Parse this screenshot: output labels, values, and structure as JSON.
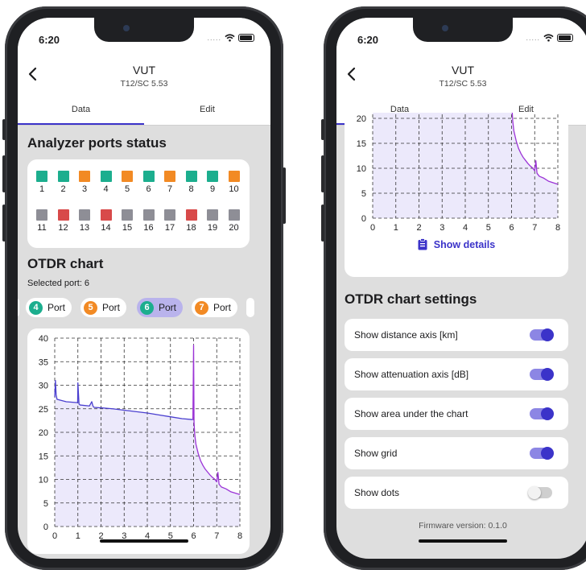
{
  "colors": {
    "accent": "#3b33c9",
    "port_ok": "#1cae8e",
    "port_warn": "#f28a24",
    "port_error": "#d84a4a",
    "port_off": "#8e8e96",
    "trace_blue": "#4a3fcf",
    "trace_purple": "#9b33d6",
    "area_fill": "#ece9fb"
  },
  "status": {
    "time": "6:20",
    "dots": "....."
  },
  "header": {
    "title": "VUT",
    "subtitle": "T12/SC 5.53"
  },
  "tabs": [
    {
      "label": "Data",
      "active": true
    },
    {
      "label": "Edit",
      "active": false
    }
  ],
  "ports_section": {
    "title": "Analyzer ports status",
    "ports": [
      {
        "num": "1",
        "status": "ok"
      },
      {
        "num": "2",
        "status": "ok"
      },
      {
        "num": "3",
        "status": "warn"
      },
      {
        "num": "4",
        "status": "ok"
      },
      {
        "num": "5",
        "status": "warn"
      },
      {
        "num": "6",
        "status": "ok"
      },
      {
        "num": "7",
        "status": "warn"
      },
      {
        "num": "8",
        "status": "ok"
      },
      {
        "num": "9",
        "status": "ok"
      },
      {
        "num": "10",
        "status": "warn"
      },
      {
        "num": "11",
        "status": "off"
      },
      {
        "num": "12",
        "status": "error"
      },
      {
        "num": "13",
        "status": "off"
      },
      {
        "num": "14",
        "status": "error"
      },
      {
        "num": "15",
        "status": "off"
      },
      {
        "num": "16",
        "status": "off"
      },
      {
        "num": "17",
        "status": "off"
      },
      {
        "num": "18",
        "status": "error"
      },
      {
        "num": "19",
        "status": "off"
      },
      {
        "num": "20",
        "status": "off"
      }
    ]
  },
  "otdr": {
    "title": "OTDR chart",
    "selected_label": "Selected port: 6",
    "chips": [
      {
        "num": "4",
        "label": "Port",
        "color": "#1cae8e",
        "active": false
      },
      {
        "num": "5",
        "label": "Port",
        "color": "#f28a24",
        "active": false
      },
      {
        "num": "6",
        "label": "Port",
        "color": "#1cae8e",
        "active": true
      },
      {
        "num": "7",
        "label": "Port",
        "color": "#f28a24",
        "active": false
      }
    ],
    "show_details": "Show details"
  },
  "chart_data": {
    "type": "line",
    "x_ticks": [
      "0",
      "1",
      "2",
      "3",
      "4",
      "5",
      "6",
      "7",
      "8"
    ],
    "y_ticks": [
      "0",
      "5",
      "10",
      "15",
      "20",
      "25",
      "30",
      "35",
      "40"
    ],
    "xlim": [
      0,
      8
    ],
    "ylim": [
      0,
      40
    ],
    "grid": true,
    "area_under_chart": true,
    "series": [
      {
        "x": [
          0,
          0.03,
          0.06,
          0.1,
          0.5,
          0.99,
          1.0,
          1.05,
          1.1,
          1.5,
          1.6,
          1.65,
          1.7,
          2.0,
          2.5,
          3.0,
          3.5,
          4.0,
          4.5,
          5.0,
          5.5,
          5.97
        ],
        "y": [
          27.5,
          31,
          28,
          27,
          26.5,
          26.3,
          30.5,
          26,
          25.8,
          25.6,
          26.5,
          25.6,
          25.3,
          25.2,
          25,
          24.7,
          24.4,
          24.1,
          23.7,
          23.3,
          22.9,
          22.7
        ]
      },
      {
        "x": [
          5.97,
          6.0,
          6.02,
          6.05,
          6.1,
          6.2,
          6.3,
          6.4,
          6.5,
          6.6,
          6.7,
          6.8,
          6.9,
          7.0,
          7.05,
          7.1,
          7.2,
          7.4,
          7.6,
          7.8,
          8.0
        ],
        "y": [
          22.7,
          38.5,
          22,
          19.5,
          17.5,
          15.5,
          14,
          13,
          12.2,
          11.6,
          11,
          10.5,
          10.1,
          9.5,
          11.5,
          9.0,
          8.4,
          8.0,
          7.4,
          7.1,
          6.8
        ]
      }
    ]
  },
  "settings": {
    "title": "OTDR chart settings",
    "items": [
      {
        "label": "Show distance axis [km]",
        "on": true
      },
      {
        "label": "Show attenuation axis [dB]",
        "on": true
      },
      {
        "label": "Show area under the chart",
        "on": true
      },
      {
        "label": "Show grid",
        "on": true
      },
      {
        "label": "Show dots",
        "on": false
      }
    ],
    "firmware": "Firmware version: 0.1.0"
  }
}
